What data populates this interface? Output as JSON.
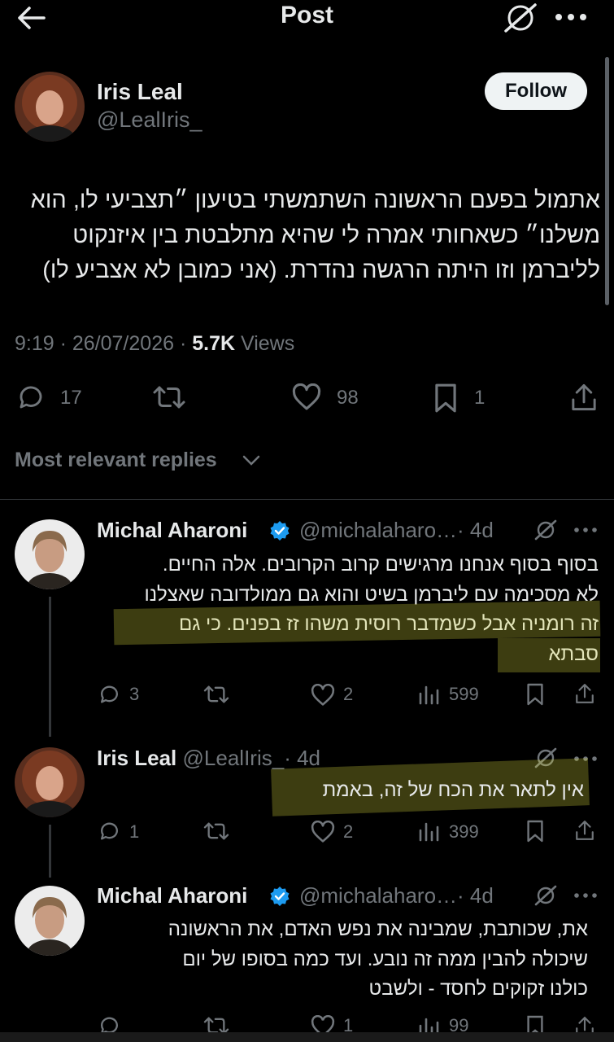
{
  "header": {
    "title": "Post"
  },
  "post": {
    "author_name": "Iris Leal",
    "author_handle": "@LealIris_",
    "follow_label": "Follow",
    "text_lines": [
      "אתמול בפעם הראשונה השתמשתי בטיעון ״תצביעי לו, הוא",
      "משלנו״ כשאחותי אמרה לי שהיא מתלבטת בין איזנקוט",
      "לליברמן וזו היתה הרגשה נהדרת. (אני כמובן לא אצביע לו)"
    ],
    "meta_time": "9:19 · 26/07/2026 · ",
    "meta_views_count": "5.7K",
    "meta_views_label": " Views",
    "stats": {
      "replies": "17",
      "likes": "98",
      "bookmarks": "1"
    }
  },
  "replies_filter_label": "Most relevant replies",
  "replies": [
    {
      "name": "Michal Aharoni",
      "handle": "@michalaharo…",
      "time": "· 4d",
      "lines": [
        "בסוף בסוף אנחנו מרגישים קרוב הקרובים. אלה החיים.",
        "לא מסכימה עם ליברמן בשיט והוא גם ממולדובה שאצלנו",
        "זה רומניה אבל כשמדבר רוסית משהו זז בפנים. כי גם",
        "סבתא"
      ],
      "replies": "3",
      "likes": "2",
      "views": "599"
    },
    {
      "name": "Iris Leal",
      "handle": "@LealIris_",
      "time": "· 4d",
      "lines": [
        "אין לתאר את הכח של זה, באמת"
      ],
      "replies": "1",
      "likes": "2",
      "views": "399"
    },
    {
      "name": "Michal Aharoni",
      "handle": "@michalaharo…",
      "time": "· 4d",
      "lines": [
        "את, שכותבת, שמבינה את נפש האדם, את הראשונה",
        "שיכולה להבין ממה זה נובע. ועד כמה בסופו של יום",
        "כולנו זקוקים לחסד - ולשבט"
      ],
      "likes": "1",
      "views": "99"
    }
  ],
  "colors": {
    "background": "#000000",
    "verified": "#1d9bf0",
    "text": "#e7e9ea",
    "muted": "#71767b",
    "highlight": "#dcdc3c"
  },
  "icons": [
    "back-arrow-icon",
    "grok-icon",
    "more-icon",
    "reply-icon",
    "retweet-icon",
    "like-icon",
    "bookmark-icon",
    "share-icon",
    "views-icon",
    "verified-badge-icon",
    "chevron-down-icon"
  ]
}
